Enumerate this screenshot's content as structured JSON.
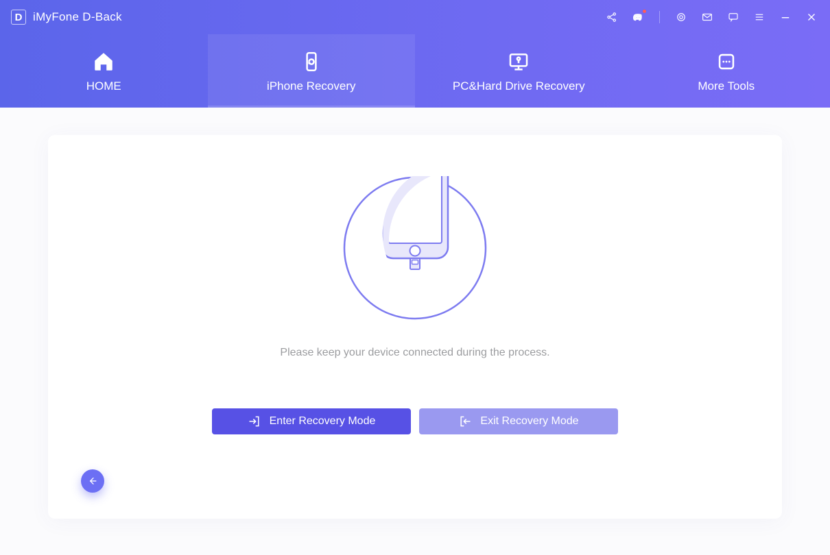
{
  "app": {
    "title": "iMyFone D-Back",
    "logo_letter": "D"
  },
  "titlebar_icons": {
    "share": "share-icon",
    "community": "community-icon",
    "settings": "settings-icon",
    "mail": "mail-icon",
    "feedback": "feedback-icon",
    "menu": "menu-icon",
    "minimize": "minimize-icon",
    "close": "close-icon"
  },
  "tabs": [
    {
      "label": "HOME",
      "icon": "home-icon",
      "active": false
    },
    {
      "label": "iPhone Recovery",
      "icon": "phone-refresh-icon",
      "active": true
    },
    {
      "label": "PC&Hard Drive Recovery",
      "icon": "monitor-key-icon",
      "active": false
    },
    {
      "label": "More Tools",
      "icon": "more-tools-icon",
      "active": false
    }
  ],
  "main": {
    "instruction": "Please keep your device connected during the process.",
    "enter_button": "Enter Recovery Mode",
    "exit_button": "Exit Recovery Mode"
  }
}
